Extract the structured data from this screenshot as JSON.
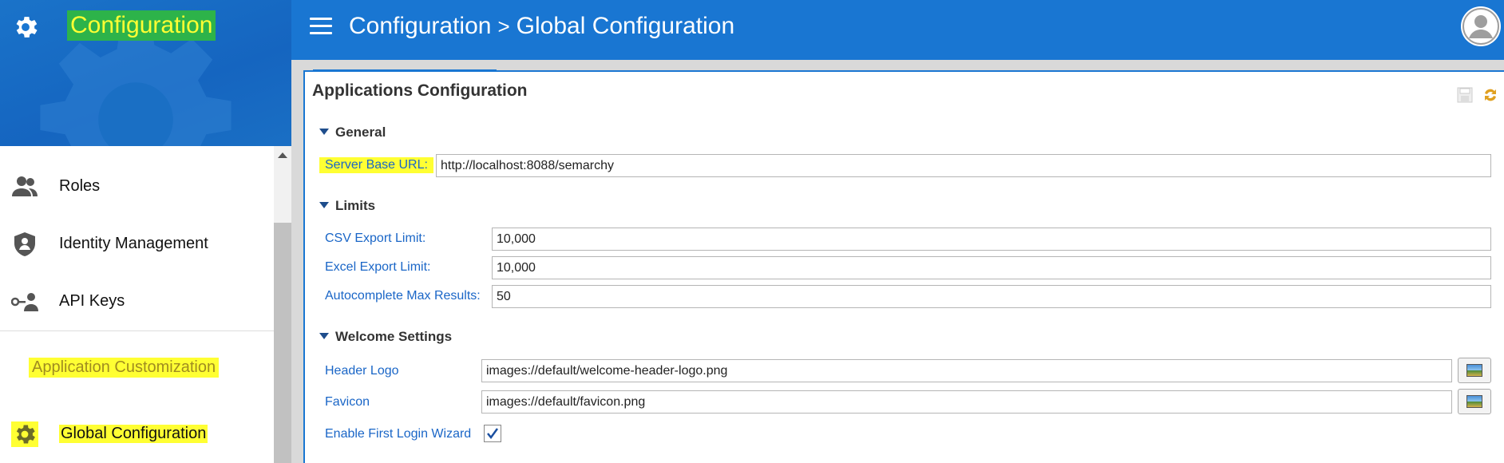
{
  "app": {
    "title": "Configuration"
  },
  "breadcrumb": {
    "root": "Configuration",
    "separator": ">",
    "current": "Global Configuration"
  },
  "sidebar": {
    "items": [
      {
        "label": "Roles"
      },
      {
        "label": "Identity Management"
      },
      {
        "label": "API Keys"
      },
      {
        "label": "Application Customization"
      },
      {
        "label": "Global Configuration"
      }
    ]
  },
  "panel": {
    "title": "Applications Configuration",
    "sections": {
      "general": {
        "title": "General",
        "server_base_url_label": "Server Base URL:",
        "server_base_url_value": "http://localhost:8088/semarchy"
      },
      "limits": {
        "title": "Limits",
        "csv_label": "CSV Export Limit:",
        "csv_value": "10,000",
        "excel_label": "Excel Export Limit:",
        "excel_value": "10,000",
        "autocomplete_label": "Autocomplete Max Results:",
        "autocomplete_value": "50"
      },
      "welcome": {
        "title": "Welcome Settings",
        "header_logo_label": "Header Logo",
        "header_logo_value": "images://default/welcome-header-logo.png",
        "favicon_label": "Favicon",
        "favicon_value": "images://default/favicon.png",
        "wizard_label": "Enable First Login Wizard",
        "wizard_checked": true
      }
    }
  },
  "colors": {
    "header": "#1976d2",
    "highlight": "#ffff33",
    "label_blue": "#1a66c7"
  }
}
